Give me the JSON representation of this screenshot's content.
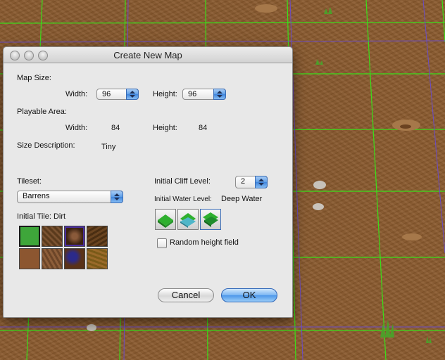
{
  "dialog": {
    "title": "Create New Map",
    "map_size_label": "Map Size:",
    "width_label": "Width:",
    "width_value": "96",
    "height_label": "Height:",
    "height_value": "96",
    "playable_area_label": "Playable Area:",
    "playable_width_label": "Width:",
    "playable_width_value": "84",
    "playable_height_label": "Height:",
    "playable_height_value": "84",
    "size_description_label": "Size Description:",
    "size_description_value": "Tiny",
    "tileset_label": "Tileset:",
    "tileset_value": "Barrens",
    "initial_tile_label": "Initial Tile: Dirt",
    "tiles": [
      "grass",
      "rough-dirt",
      "pebbles",
      "dark-dirt",
      "dirt",
      "rocky-dirt",
      "blight-rocks",
      "grassy-dirt"
    ],
    "cliff_level_label": "Initial Cliff Level:",
    "cliff_level_value": "2",
    "water_level_label": "Initial Water Level:",
    "water_level_value": "Deep Water",
    "water_tools": [
      "land-terrain-icon",
      "shallow-water-icon",
      "deep-water-icon"
    ],
    "random_height_label": "Random height field",
    "random_height_checked": false,
    "cancel_label": "Cancel",
    "ok_label": "OK"
  },
  "colors": {
    "terrain": "#8a5a2e",
    "grid_green": "#39e019",
    "grid_purple": "#6a4cc8",
    "dialog_bg": "#e8e8e8",
    "accent": "#4c97ea"
  }
}
